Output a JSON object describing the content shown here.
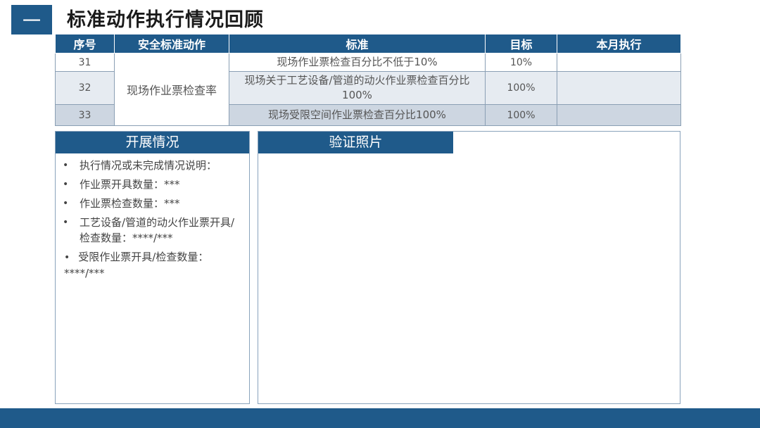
{
  "header": {
    "badge": "一",
    "title": "标准动作执行情况回顾"
  },
  "table": {
    "columns": [
      "序号",
      "安全标准动作",
      "标准",
      "目标",
      "本月执行"
    ],
    "action": "现场作业票检查率",
    "rows": [
      {
        "no": "31",
        "standard": "现场作业票检查百分比不低于10%",
        "target": "10%",
        "actual": ""
      },
      {
        "no": "32",
        "standard": "现场关于工艺设备/管道的动火作业票检查百分比100%",
        "target": "100%",
        "actual": ""
      },
      {
        "no": "33",
        "standard": "现场受限空间作业票检查百分比100%",
        "target": "100%",
        "actual": ""
      }
    ]
  },
  "left_panel": {
    "title": "开展情况",
    "bullet_symbol": "•",
    "items": [
      "执行情况或未完成情况说明：",
      "作业票开具数量：***",
      "作业票检查数量：***",
      "工艺设备/管道的动火作业票开具/检查数量：****/***",
      "受限作业票开具/检查数量：****/***"
    ]
  },
  "right_panel": {
    "title": "验证照片"
  },
  "colors": {
    "primary": "#1f5a8a",
    "row_alt": "#e6ebf1",
    "row_dark": "#cdd6e1",
    "border": "#8aa3bc"
  }
}
